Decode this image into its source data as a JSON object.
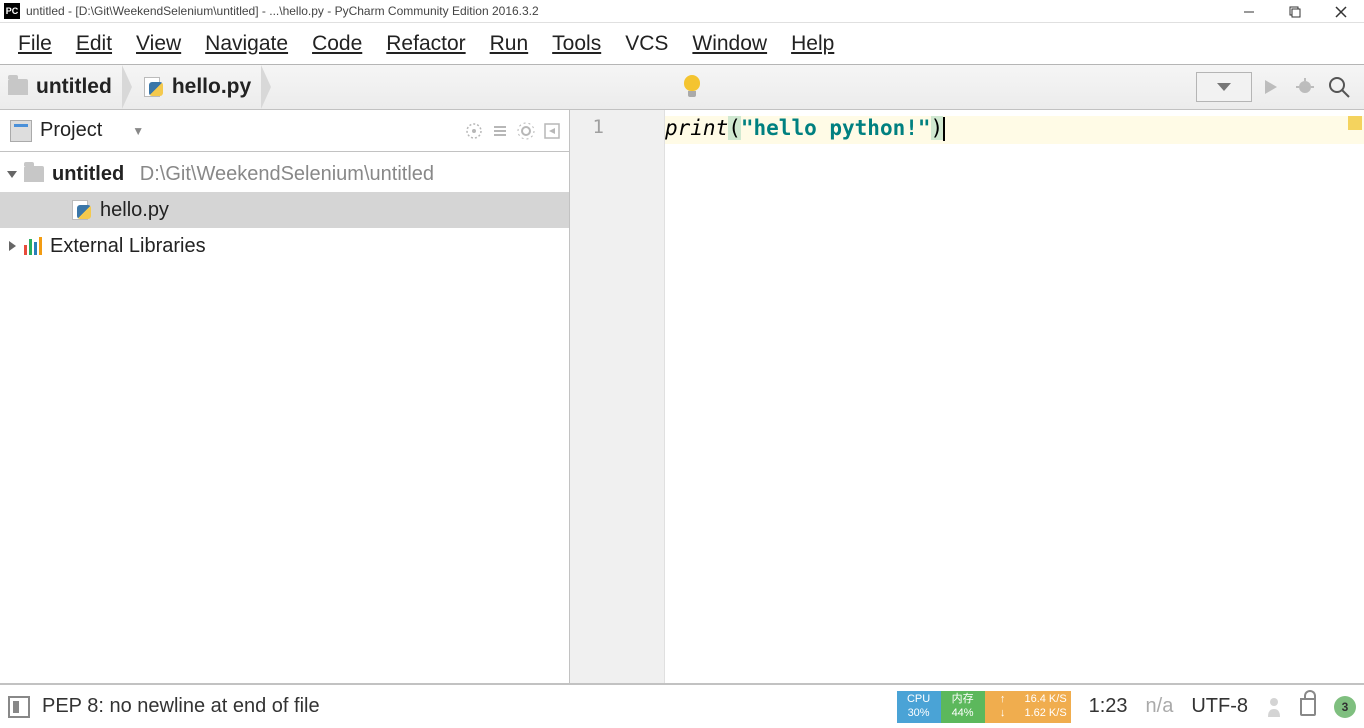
{
  "title": "untitled - [D:\\Git\\WeekendSelenium\\untitled] - ...\\hello.py - PyCharm Community Edition 2016.3.2",
  "menu": {
    "file": "File",
    "edit": "Edit",
    "view": "View",
    "navigate": "Navigate",
    "code": "Code",
    "refactor": "Refactor",
    "run": "Run",
    "tools": "Tools",
    "vcs": "VCS",
    "window": "Window",
    "help": "Help"
  },
  "breadcrumb": {
    "project": "untitled",
    "file": "hello.py"
  },
  "projectPanel": {
    "title": "Project",
    "root": {
      "name": "untitled",
      "path": "D:\\Git\\WeekendSelenium\\untitled",
      "children": [
        {
          "name": "hello.py",
          "type": "python"
        }
      ]
    },
    "external": "External Libraries"
  },
  "editor": {
    "line1_number": "1",
    "line1_fn": "print",
    "line1_p_open": "(",
    "line1_str": "\"hello python!\"",
    "line1_p_close": ")"
  },
  "status": {
    "message": "PEP 8: no newline at end of file",
    "cpu_label": "CPU",
    "cpu_val": "30%",
    "mem_label": "内存",
    "mem_val": "44%",
    "up_arrow": "↑",
    "down_arrow": "↓",
    "net_up": "16.4 K/S",
    "net_down": "1.62 K/S",
    "cursor": "1:23",
    "lineSep": "n/a",
    "encoding": "UTF-8",
    "badge": "3"
  }
}
